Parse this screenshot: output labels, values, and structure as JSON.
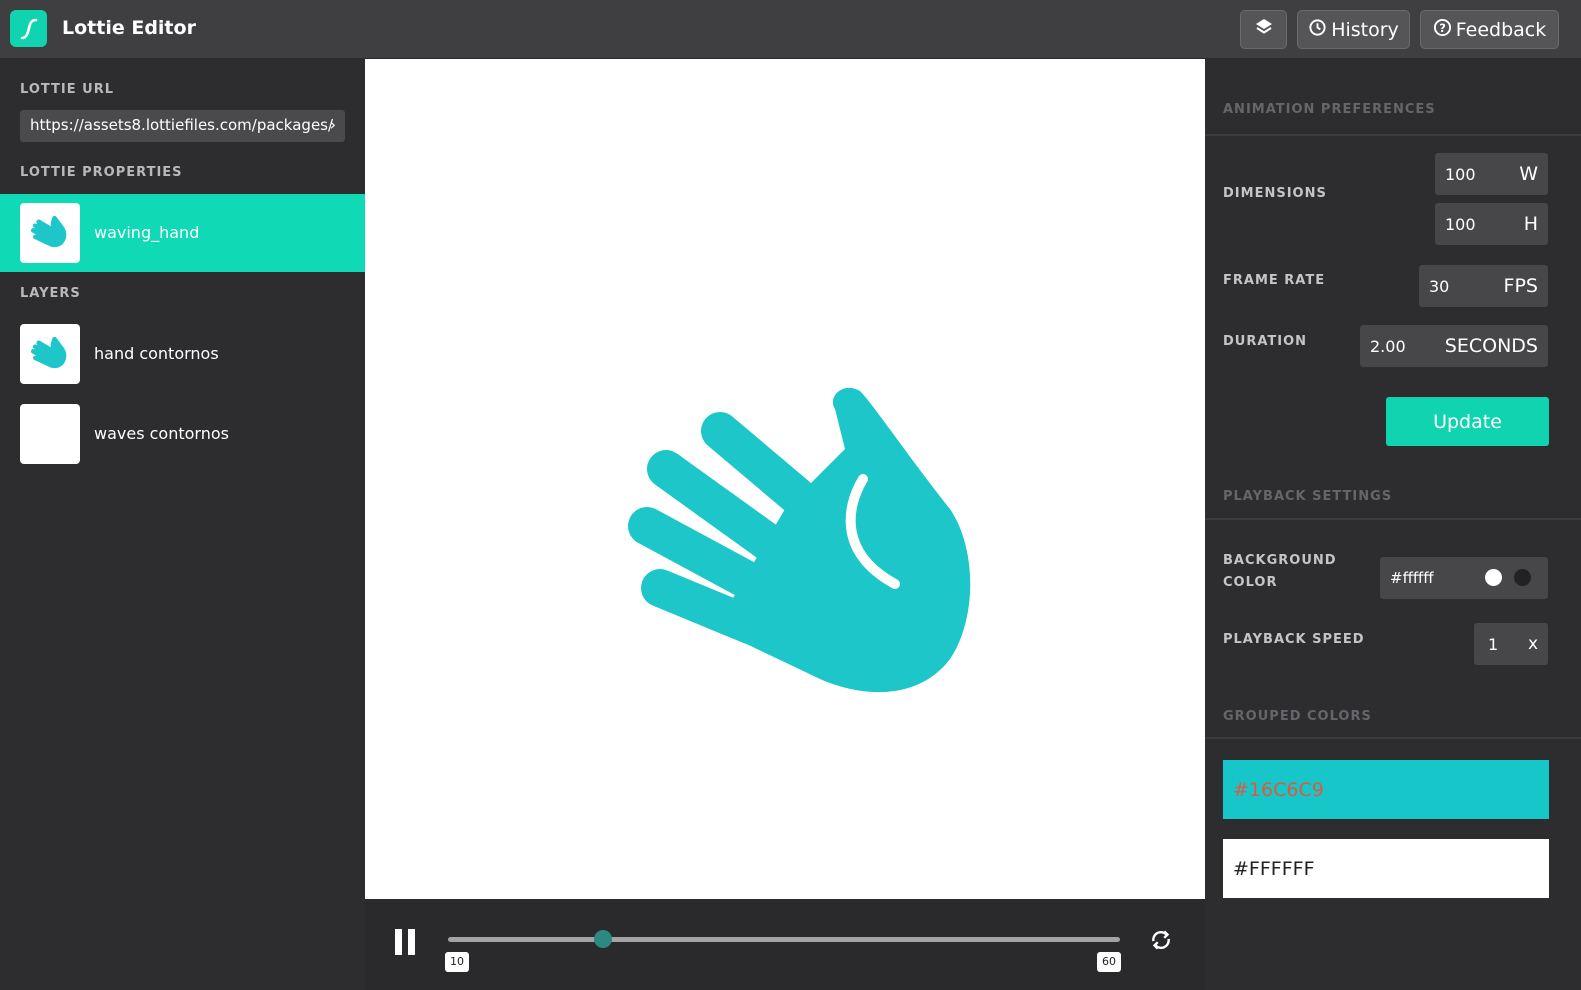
{
  "app": {
    "title": "Lottie Editor"
  },
  "toolbar": {
    "layers_icon": "layers-icon",
    "history_label": "History",
    "feedback_label": "Feedback"
  },
  "left": {
    "url_label": "LOTTIE URL",
    "url_value": "https://assets8.lottiefiles.com/packages/",
    "properties_label": "LOTTIE PROPERTIES",
    "property_item": "waving_hand",
    "layers_label": "LAYERS",
    "layers": [
      {
        "name": "hand contornos"
      },
      {
        "name": "waves contornos"
      }
    ]
  },
  "player": {
    "start_frame": "10",
    "end_frame": "60",
    "progress": 0.23
  },
  "right": {
    "animation_preferences": "ANIMATION PREFERENCES",
    "dimensions_label": "DIMENSIONS",
    "width": "100",
    "width_unit": "W",
    "height": "100",
    "height_unit": "H",
    "frame_rate_label": "FRAME RATE",
    "frame_rate": "30",
    "frame_rate_unit": "FPS",
    "duration_label": "DURATION",
    "duration": "2.00",
    "duration_unit": "SECONDS",
    "update_label": "Update",
    "playback_settings": "PLAYBACK SETTINGS",
    "bg_color_label_1": "BACKGROUND",
    "bg_color_label_2": "COLOR",
    "bg_color": "#ffffff",
    "speed_label": "PLAYBACK SPEED",
    "speed": "1",
    "speed_unit": "x",
    "grouped_colors": "GROUPED COLORS",
    "colors": [
      {
        "hex": "#16C6C9"
      },
      {
        "hex": "#FFFFFF"
      }
    ]
  },
  "colors": {
    "accent": "#10d3b0",
    "hand": "#1cc6c9"
  }
}
